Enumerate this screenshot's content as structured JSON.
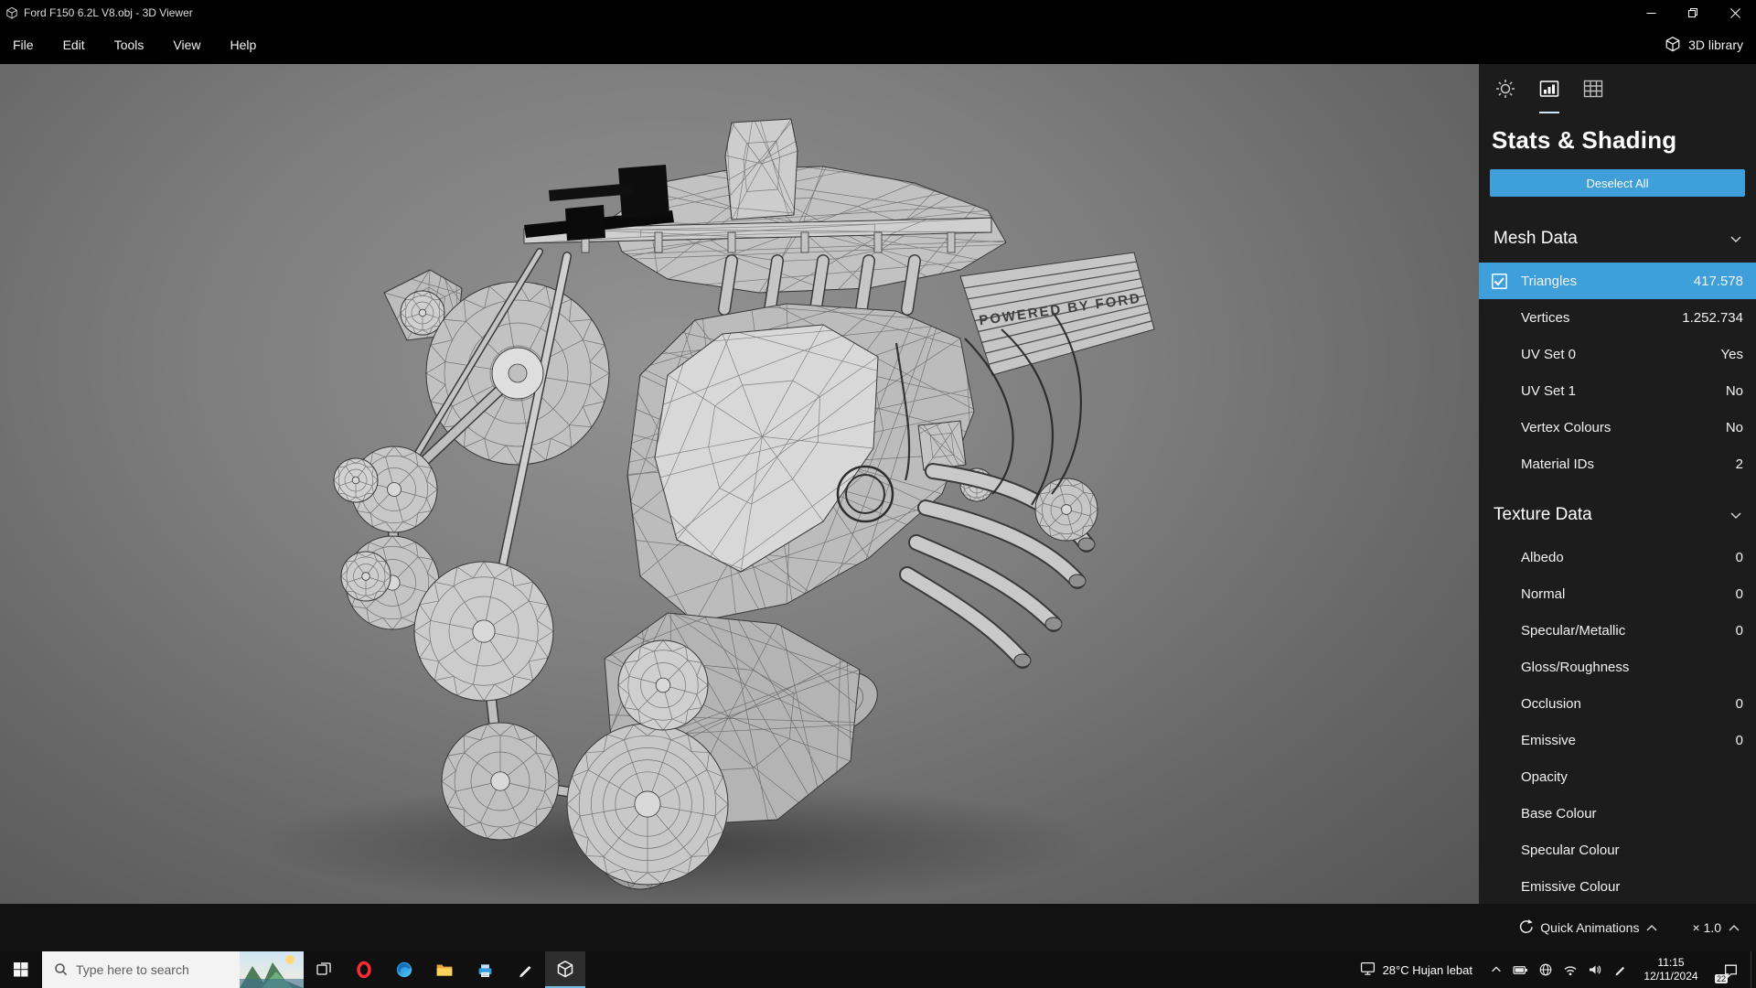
{
  "window": {
    "title": "Ford F150 6.2L V8.obj - 3D Viewer"
  },
  "menu": {
    "items": [
      "File",
      "Edit",
      "Tools",
      "View",
      "Help"
    ],
    "library_label": "3D library"
  },
  "model": {
    "badge_text": "POWERED BY FORD"
  },
  "panel": {
    "title": "Stats & Shading",
    "deselect_label": "Deselect All",
    "sections": [
      {
        "title": "Mesh Data",
        "rows": [
          {
            "label": "Triangles",
            "value": "417.578"
          },
          {
            "label": "Vertices",
            "value": "1.252.734"
          },
          {
            "label": "UV Set 0",
            "value": "Yes"
          },
          {
            "label": "UV Set 1",
            "value": "No"
          },
          {
            "label": "Vertex Colours",
            "value": "No"
          },
          {
            "label": "Material IDs",
            "value": "2"
          }
        ]
      },
      {
        "title": "Texture Data",
        "rows": [
          {
            "label": "Albedo",
            "value": "0"
          },
          {
            "label": "Normal",
            "value": "0"
          },
          {
            "label": "Specular/Metallic",
            "value": "0"
          },
          {
            "label": "Gloss/Roughness",
            "value": ""
          },
          {
            "label": "Occlusion",
            "value": "0"
          },
          {
            "label": "Emissive",
            "value": "0"
          },
          {
            "label": "Opacity",
            "value": ""
          },
          {
            "label": "Base Colour",
            "value": ""
          },
          {
            "label": "Specular Colour",
            "value": ""
          },
          {
            "label": "Emissive Colour",
            "value": ""
          }
        ]
      }
    ]
  },
  "bottombar": {
    "quick_animations_label": "Quick Animations",
    "multiplier_label": "× 1.0"
  },
  "taskbar": {
    "search_placeholder": "Type here to search",
    "weather": "28°C Hujan lebat",
    "time": "11:15",
    "date": "12/11/2024",
    "notification_badge": "22"
  },
  "colors": {
    "accent": "#3f9fdb",
    "panel_bg": "#1c1c1c",
    "bar_bg": "#000000",
    "taskbar_bg": "#101010",
    "viewport_center": "#8e8e8e",
    "viewport_edge": "#575757"
  },
  "icons": {
    "panel_tabs": [
      "brightness-icon",
      "stats-icon",
      "grid-icon"
    ],
    "titlebar": [
      "minimize-icon",
      "restore-icon",
      "close-icon"
    ],
    "taskbar": [
      "start-icon",
      "search-icon",
      "task-view-icon",
      "opera-icon",
      "edge-icon",
      "file-explorer-icon",
      "printer-app-icon",
      "pen-app-icon",
      "3d-viewer-icon"
    ],
    "tray": [
      "tray-expand-icon",
      "battery-icon",
      "network-icon",
      "wifi-icon",
      "volume-icon",
      "pen-icon",
      "action-center-icon"
    ]
  }
}
